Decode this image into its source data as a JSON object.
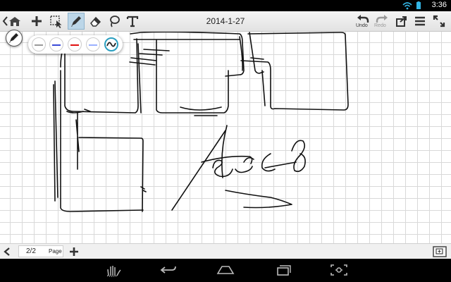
{
  "status": {
    "time": "3:36",
    "icons": [
      "wifi-icon",
      "battery-icon"
    ]
  },
  "toolbar": {
    "title": "2014-1-27",
    "undo_label": "Undo",
    "redo_label": "Redo",
    "icons": [
      "back-chevron-icon",
      "home-icon",
      "add-icon",
      "select-icon",
      "pen-icon",
      "eraser-icon",
      "lasso-icon",
      "text-icon",
      "undo-icon",
      "redo-icon",
      "share-icon",
      "menu-icon",
      "fullscreen-icon"
    ]
  },
  "pen_palette": {
    "swatch_colors": [
      "#9a9a9a",
      "#3a4ad8",
      "#e01010",
      "#9ab0ff",
      "#222222"
    ],
    "selected_index": 4
  },
  "page_nav": {
    "page_indicator": "2/2",
    "page_label": "Page"
  },
  "colors": {
    "accent": "#2a9fc0",
    "toolbar_active": "#bcd6e8"
  }
}
